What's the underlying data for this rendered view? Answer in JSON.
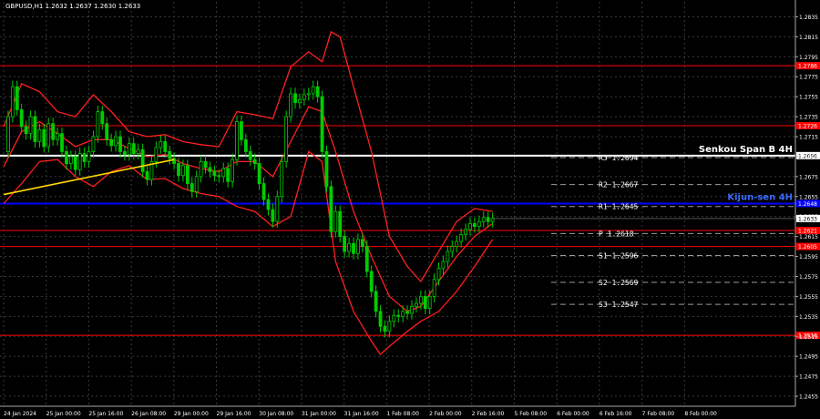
{
  "chart_data": {
    "type": "line",
    "title": "GBPUSD,H1  1.2632 1.2637 1.2630 1.2633",
    "symbol": "GBPUSD,H1",
    "ohlc": {
      "open": 1.2632,
      "high": 1.2637,
      "low": 1.263,
      "close": 1.2633
    },
    "ylim": [
      1.2445,
      1.285
    ],
    "y_ticks": [
      "1.2835",
      "1.2815",
      "1.2795",
      "1.2775",
      "1.2755",
      "1.2735",
      "1.2715",
      "1.2695",
      "1.2675",
      "1.2655",
      "1.2635",
      "1.2615",
      "1.2595",
      "1.2575",
      "1.2555",
      "1.2535",
      "1.2515",
      "1.2495",
      "1.2475",
      "1.2455"
    ],
    "x_ticks": [
      "24 Jan 2024",
      "25 Jan 00:00",
      "25 Jan 16:00",
      "26 Jan 08:00",
      "29 Jan 00:00",
      "29 Jan 16:00",
      "30 Jan 08:00",
      "31 Jan 00:00",
      "31 Jan 16:00",
      "1 Feb 08:00",
      "2 Feb 00:00",
      "2 Feb 16:00",
      "5 Feb 08:00",
      "6 Feb 00:00",
      "6 Feb 16:00",
      "7 Feb 08:00",
      "8 Feb 00:00"
    ],
    "hours_total": 130,
    "grid": true,
    "current_price": {
      "label": "1.2633",
      "value": 1.2633
    },
    "horizontal_levels": [
      {
        "name": "Senkou Span B 4H",
        "value": 1.2696,
        "label": "1.2696",
        "color": "#ffffff"
      },
      {
        "name": "Kijun-sen 4H",
        "value": 1.2648,
        "label": "1.2648",
        "color": "#0000ff"
      },
      {
        "name": "support-resistance",
        "value": 1.2786,
        "label": "1.2786",
        "color": "#ff0000"
      },
      {
        "name": "support-resistance",
        "value": 1.2726,
        "label": "1.2726",
        "color": "#ff0000"
      },
      {
        "name": "support-resistance",
        "value": 1.2621,
        "label": "1.2621",
        "color": "#ff0000"
      },
      {
        "name": "support-resistance",
        "value": 1.2605,
        "label": "1.2605",
        "color": "#ff0000"
      },
      {
        "name": "support-resistance",
        "value": 1.2516,
        "label": "1.2516",
        "color": "#ff0000"
      }
    ],
    "pivot_levels": [
      {
        "name": "R3",
        "value": 1.2694,
        "label": "R3 1.2694"
      },
      {
        "name": "R2",
        "value": 1.2667,
        "label": "R2 1.2667"
      },
      {
        "name": "R1",
        "value": 1.2645,
        "label": "R1 1.2645"
      },
      {
        "name": "P",
        "value": 1.2618,
        "label": "P 1.2618"
      },
      {
        "name": "S1",
        "value": 1.2596,
        "label": "S1 1.2596"
      },
      {
        "name": "S2",
        "value": 1.2569,
        "label": "S2 1.2569"
      },
      {
        "name": "S3",
        "value": 1.2547,
        "label": "S3 1.2547"
      }
    ],
    "trendline": {
      "from_hour": 0,
      "from_value": 1.2657,
      "to_hour": 38,
      "to_value": 1.2692,
      "color": "#ffd700"
    },
    "price_path": [
      [
        0,
        1.27
      ],
      [
        1,
        1.2735
      ],
      [
        2,
        1.2765
      ],
      [
        3,
        1.2742
      ],
      [
        4,
        1.2725
      ],
      [
        5,
        1.2718
      ],
      [
        6,
        1.2735
      ],
      [
        7,
        1.271
      ],
      [
        8,
        1.2722
      ],
      [
        9,
        1.2705
      ],
      [
        10,
        1.2728
      ],
      [
        11,
        1.2712
      ],
      [
        12,
        1.2718
      ],
      [
        13,
        1.27
      ],
      [
        14,
        1.2688
      ],
      [
        15,
        1.2695
      ],
      [
        16,
        1.2682
      ],
      [
        17,
        1.2698
      ],
      [
        18,
        1.269
      ],
      [
        19,
        1.27
      ],
      [
        20,
        1.2715
      ],
      [
        21,
        1.274
      ],
      [
        22,
        1.2728
      ],
      [
        23,
        1.2712
      ],
      [
        24,
        1.2706
      ],
      [
        25,
        1.2715
      ],
      [
        26,
        1.27
      ],
      [
        27,
        1.2697
      ],
      [
        28,
        1.2708
      ],
      [
        29,
        1.2698
      ],
      [
        30,
        1.2702
      ],
      [
        31,
        1.268
      ],
      [
        32,
        1.2672
      ],
      [
        33,
        1.269
      ],
      [
        34,
        1.2704
      ],
      [
        35,
        1.271
      ],
      [
        36,
        1.27
      ],
      [
        37,
        1.2693
      ],
      [
        38,
        1.2688
      ],
      [
        39,
        1.2676
      ],
      [
        40,
        1.2686
      ],
      [
        41,
        1.2668
      ],
      [
        42,
        1.266
      ],
      [
        43,
        1.2675
      ],
      [
        44,
        1.269
      ],
      [
        45,
        1.2684
      ],
      [
        46,
        1.268
      ],
      [
        47,
        1.2676
      ],
      [
        48,
        1.2675
      ],
      [
        49,
        1.2683
      ],
      [
        50,
        1.267
      ],
      [
        51,
        1.2692
      ],
      [
        52,
        1.273
      ],
      [
        53,
        1.2712
      ],
      [
        54,
        1.27
      ],
      [
        55,
        1.2692
      ],
      [
        56,
        1.2688
      ],
      [
        57,
        1.2668
      ],
      [
        58,
        1.2652
      ],
      [
        59,
        1.2642
      ],
      [
        60,
        1.263
      ],
      [
        61,
        1.2655
      ],
      [
        62,
        1.269
      ],
      [
        63,
        1.2735
      ],
      [
        64,
        1.2758
      ],
      [
        65,
        1.2749
      ],
      [
        66,
        1.2752
      ],
      [
        67,
        1.2757
      ],
      [
        68,
        1.2758
      ],
      [
        69,
        1.2765
      ],
      [
        70,
        1.2755
      ],
      [
        71,
        1.27
      ],
      [
        72,
        1.2665
      ],
      [
        73,
        1.262
      ],
      [
        74,
        1.264
      ],
      [
        75,
        1.2615
      ],
      [
        76,
        1.26
      ],
      [
        77,
        1.2608
      ],
      [
        78,
        1.2598
      ],
      [
        79,
        1.2612
      ],
      [
        80,
        1.2605
      ],
      [
        81,
        1.258
      ],
      [
        82,
        1.256
      ],
      [
        83,
        1.254
      ],
      [
        84,
        1.2525
      ],
      [
        85,
        1.252
      ],
      [
        86,
        1.253
      ],
      [
        87,
        1.2536
      ],
      [
        88,
        1.2535
      ],
      [
        89,
        1.254
      ],
      [
        90,
        1.2538
      ],
      [
        91,
        1.2545
      ],
      [
        92,
        1.2548
      ],
      [
        93,
        1.2555
      ],
      [
        94,
        1.2543
      ],
      [
        95,
        1.2555
      ],
      [
        96,
        1.2572
      ],
      [
        97,
        1.2583
      ],
      [
        98,
        1.259
      ],
      [
        99,
        1.26
      ],
      [
        100,
        1.2605
      ],
      [
        101,
        1.261
      ],
      [
        102,
        1.2617
      ],
      [
        103,
        1.2622
      ],
      [
        104,
        1.2628
      ],
      [
        105,
        1.2625
      ],
      [
        106,
        1.263
      ],
      [
        107,
        1.2634
      ],
      [
        108,
        1.263
      ],
      [
        109,
        1.2633
      ]
    ],
    "bollinger_upper": [
      [
        0,
        1.2725
      ],
      [
        4,
        1.2768
      ],
      [
        8,
        1.276
      ],
      [
        12,
        1.274
      ],
      [
        16,
        1.2735
      ],
      [
        20,
        1.2757
      ],
      [
        24,
        1.274
      ],
      [
        28,
        1.272
      ],
      [
        32,
        1.2715
      ],
      [
        36,
        1.2717
      ],
      [
        40,
        1.271
      ],
      [
        44,
        1.2707
      ],
      [
        48,
        1.2705
      ],
      [
        52,
        1.274
      ],
      [
        56,
        1.2737
      ],
      [
        60,
        1.2733
      ],
      [
        64,
        1.2785
      ],
      [
        68,
        1.28
      ],
      [
        71,
        1.279
      ],
      [
        73,
        1.282
      ],
      [
        75,
        1.2815
      ],
      [
        78,
        1.2765
      ],
      [
        82,
        1.27
      ],
      [
        86,
        1.2615
      ],
      [
        90,
        1.2585
      ],
      [
        93,
        1.257
      ],
      [
        97,
        1.26
      ],
      [
        101,
        1.263
      ],
      [
        105,
        1.2643
      ],
      [
        109,
        1.264
      ]
    ],
    "bollinger_middle": [
      [
        0,
        1.2685
      ],
      [
        4,
        1.272
      ],
      [
        8,
        1.273
      ],
      [
        12,
        1.2718
      ],
      [
        16,
        1.2705
      ],
      [
        20,
        1.2712
      ],
      [
        24,
        1.2712
      ],
      [
        28,
        1.2703
      ],
      [
        32,
        1.2695
      ],
      [
        36,
        1.2697
      ],
      [
        40,
        1.2688
      ],
      [
        44,
        1.2683
      ],
      [
        48,
        1.268
      ],
      [
        52,
        1.269
      ],
      [
        56,
        1.269
      ],
      [
        60,
        1.2675
      ],
      [
        64,
        1.271
      ],
      [
        68,
        1.2745
      ],
      [
        71,
        1.274
      ],
      [
        74,
        1.27
      ],
      [
        78,
        1.264
      ],
      [
        82,
        1.2595
      ],
      [
        86,
        1.2555
      ],
      [
        90,
        1.254
      ],
      [
        93,
        1.2545
      ],
      [
        97,
        1.257
      ],
      [
        101,
        1.2595
      ],
      [
        105,
        1.2615
      ],
      [
        109,
        1.2628
      ]
    ],
    "bollinger_lower": [
      [
        0,
        1.2648
      ],
      [
        4,
        1.2668
      ],
      [
        8,
        1.269
      ],
      [
        12,
        1.2692
      ],
      [
        16,
        1.2675
      ],
      [
        20,
        1.2665
      ],
      [
        24,
        1.268
      ],
      [
        28,
        1.2686
      ],
      [
        32,
        1.2672
      ],
      [
        36,
        1.2673
      ],
      [
        40,
        1.2663
      ],
      [
        44,
        1.2658
      ],
      [
        48,
        1.2655
      ],
      [
        52,
        1.2645
      ],
      [
        56,
        1.264
      ],
      [
        60,
        1.2625
      ],
      [
        64,
        1.2635
      ],
      [
        68,
        1.27
      ],
      [
        71,
        1.269
      ],
      [
        74,
        1.259
      ],
      [
        78,
        1.254
      ],
      [
        82,
        1.251
      ],
      [
        84,
        1.2497
      ],
      [
        86,
        1.2505
      ],
      [
        90,
        1.252
      ],
      [
        93,
        1.253
      ],
      [
        97,
        1.254
      ],
      [
        101,
        1.256
      ],
      [
        105,
        1.2585
      ],
      [
        109,
        1.2612
      ]
    ]
  }
}
